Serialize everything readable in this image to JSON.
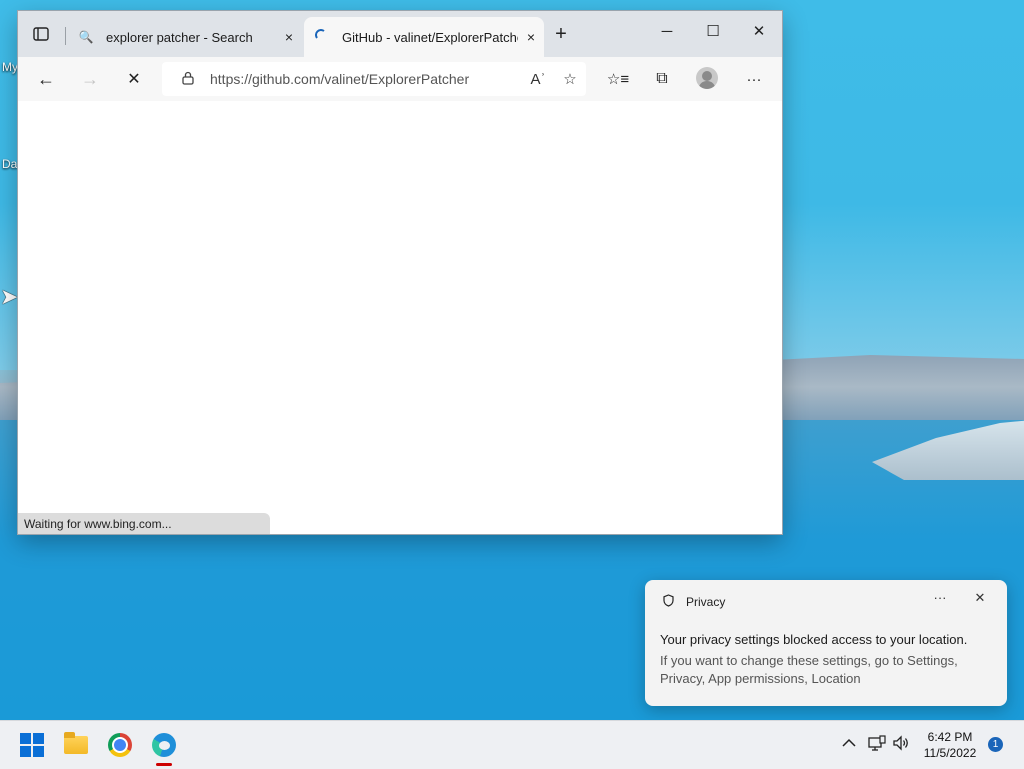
{
  "desktop": {
    "labels": [
      "My",
      "Da"
    ]
  },
  "browser": {
    "tabs": [
      {
        "title": "explorer patcher - Search",
        "icon": "search-icon",
        "close": "×"
      },
      {
        "title": "GitHub - valinet/ExplorerPatcher",
        "icon": "loading-spinner-icon",
        "close": "×"
      }
    ],
    "new_tab": "+",
    "window_controls": {
      "minimize": "─",
      "maximize": "☐",
      "close": "✕"
    },
    "toolbar": {
      "back": "←",
      "forward": "→",
      "stop": "✕",
      "url": "https://github.com/valinet/ExplorerPatcher",
      "read_aloud": "Aʾ",
      "add_favorite": "☆",
      "favorites": "☆≡",
      "collections": "⧉",
      "more": "···"
    },
    "status_text": "Waiting for www.bing.com..."
  },
  "notification": {
    "app_name": "Privacy",
    "more": "···",
    "close": "✕",
    "title": "Your privacy settings blocked access to your location.",
    "body": "If you want to change these settings, go to Settings, Privacy, App permissions, Location"
  },
  "taskbar": {
    "apps": [
      "start",
      "file-explorer",
      "chrome",
      "edge"
    ],
    "time": "6:42 PM",
    "date": "11/5/2022",
    "notification_count": "1",
    "tray": {
      "chevron": "^",
      "network": "🖧",
      "volume": "🔊"
    }
  },
  "colors": {
    "accent": "#0a6fd6",
    "taskbar_bg": "#eef0f3",
    "tabbar_bg": "#dfe3e8"
  }
}
